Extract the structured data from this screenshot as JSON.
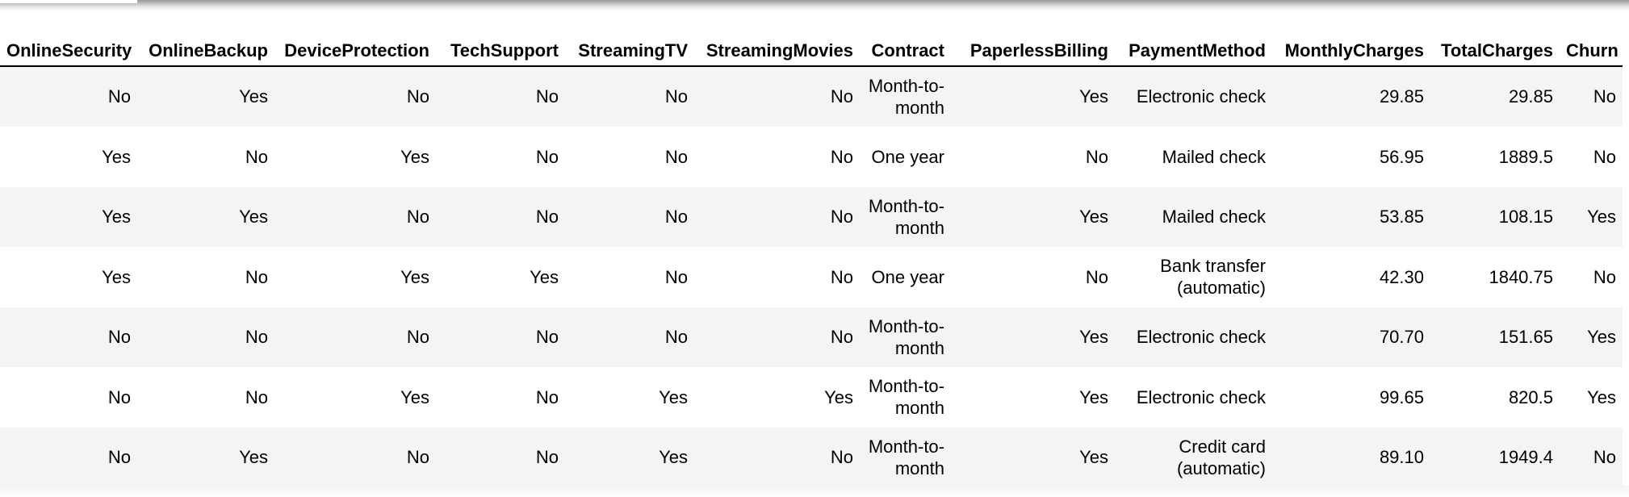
{
  "table": {
    "columns": [
      "OnlineSecurity",
      "OnlineBackup",
      "DeviceProtection",
      "TechSupport",
      "StreamingTV",
      "StreamingMovies",
      "Contract",
      "PaperlessBilling",
      "PaymentMethod",
      "MonthlyCharges",
      "TotalCharges",
      "Churn"
    ],
    "rows": [
      [
        "No",
        "Yes",
        "No",
        "No",
        "No",
        "No",
        "Month-to-month",
        "Yes",
        "Electronic check",
        "29.85",
        "29.85",
        "No"
      ],
      [
        "Yes",
        "No",
        "Yes",
        "No",
        "No",
        "No",
        "One year",
        "No",
        "Mailed check",
        "56.95",
        "1889.5",
        "No"
      ],
      [
        "Yes",
        "Yes",
        "No",
        "No",
        "No",
        "No",
        "Month-to-month",
        "Yes",
        "Mailed check",
        "53.85",
        "108.15",
        "Yes"
      ],
      [
        "Yes",
        "No",
        "Yes",
        "Yes",
        "No",
        "No",
        "One year",
        "No",
        "Bank transfer (automatic)",
        "42.30",
        "1840.75",
        "No"
      ],
      [
        "No",
        "No",
        "No",
        "No",
        "No",
        "No",
        "Month-to-month",
        "Yes",
        "Electronic check",
        "70.70",
        "151.65",
        "Yes"
      ],
      [
        "No",
        "No",
        "Yes",
        "No",
        "Yes",
        "Yes",
        "Month-to-month",
        "Yes",
        "Electronic check",
        "99.65",
        "820.5",
        "Yes"
      ],
      [
        "No",
        "Yes",
        "No",
        "No",
        "Yes",
        "No",
        "Month-to-month",
        "Yes",
        "Credit card (automatic)",
        "89.10",
        "1949.4",
        "No"
      ]
    ]
  },
  "colors": {
    "stripe": "#f4f4f4",
    "header_border": "#000000",
    "text": "#000000"
  }
}
